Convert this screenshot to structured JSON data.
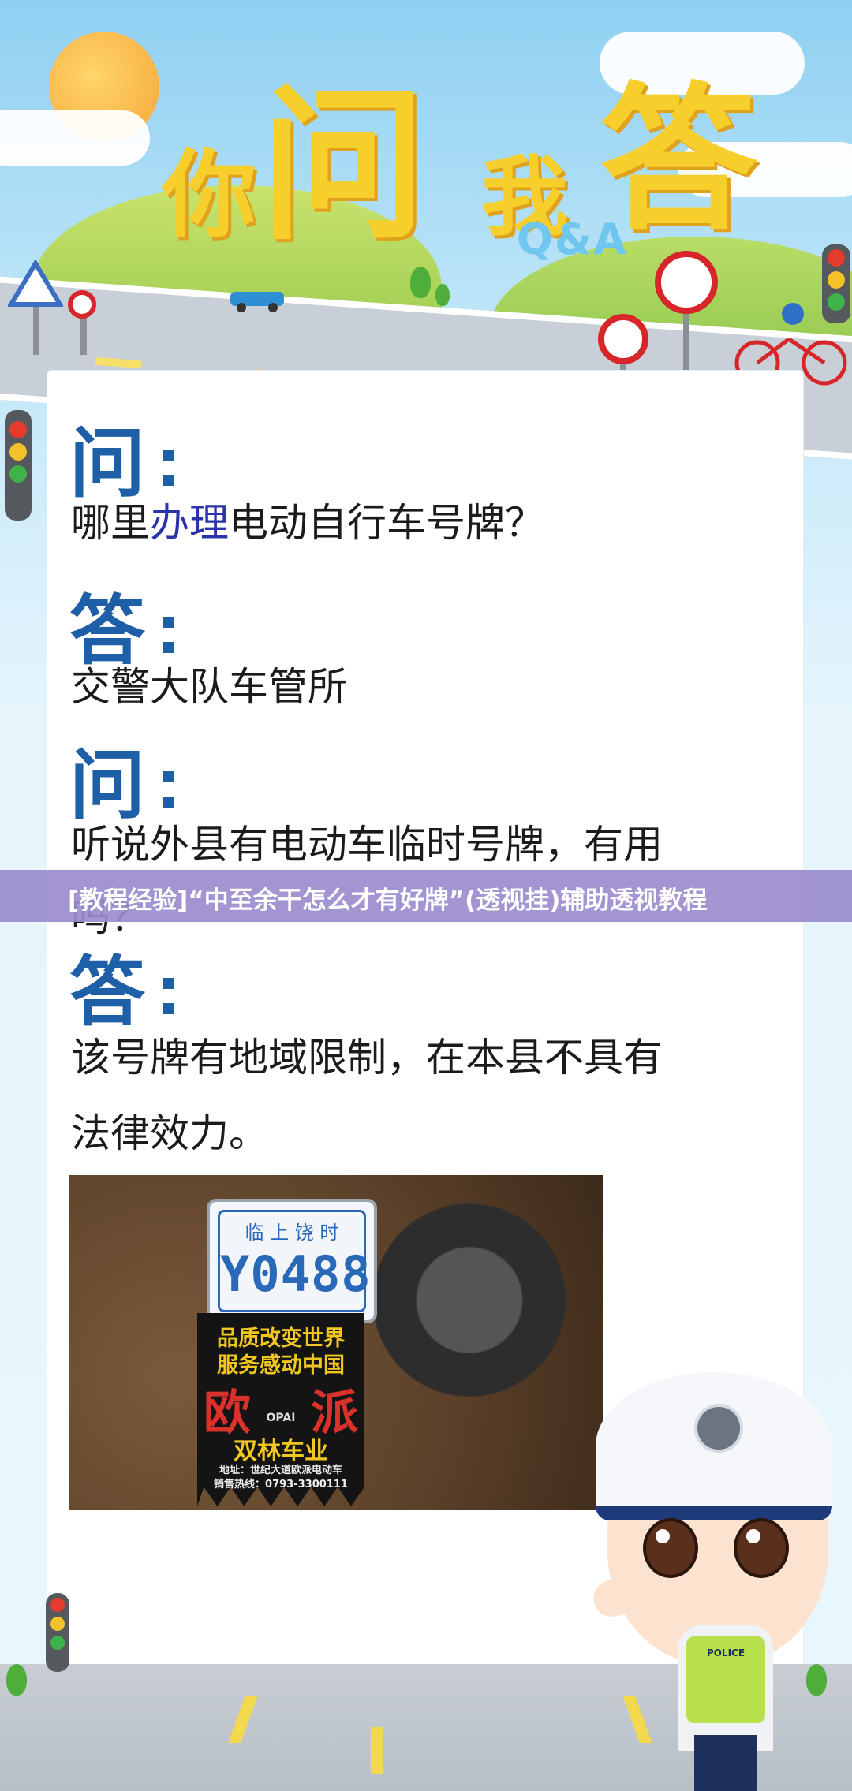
{
  "header": {
    "title_chars": [
      "你",
      "问",
      "我",
      "答"
    ],
    "subtitle": "Q&A"
  },
  "qa": [
    {
      "marker": "问",
      "text_before": "哪里",
      "text_highlight": "办理",
      "text_after": "电动自行车号牌？"
    },
    {
      "marker": "答",
      "text": "交警大队车管所"
    },
    {
      "marker": "问",
      "text_line1": "听说外县有电动车临时号牌，有用",
      "text_line2": "吗？"
    },
    {
      "marker": "答",
      "text_line1": "该号牌有地域限制，在本县不具有",
      "text_line2": "法律效力。"
    }
  ],
  "banner": {
    "text": "[教程经验]“中至余干怎么才有好牌”(透视挂)辅助透视教程"
  },
  "photo": {
    "plate_top": "临 上 饶 时",
    "plate_number": "Y0488",
    "flap_line1": "品质改变世界",
    "flap_line2": "服务感动中国",
    "flap_brand_left": "欧",
    "flap_brand_right": "派",
    "flap_logo": "OPAI",
    "flap_company": "双林车业",
    "flap_addr": "地址：世纪大道欧派电动车",
    "flap_phone": "销售热线：0793-3300111"
  },
  "officer": {
    "badge": "POLICE"
  },
  "colors": {
    "marker": "#1f5fa8",
    "highlight": "#2a34a8",
    "banner": "#9b8ccd",
    "title": "#f7cf2c"
  }
}
